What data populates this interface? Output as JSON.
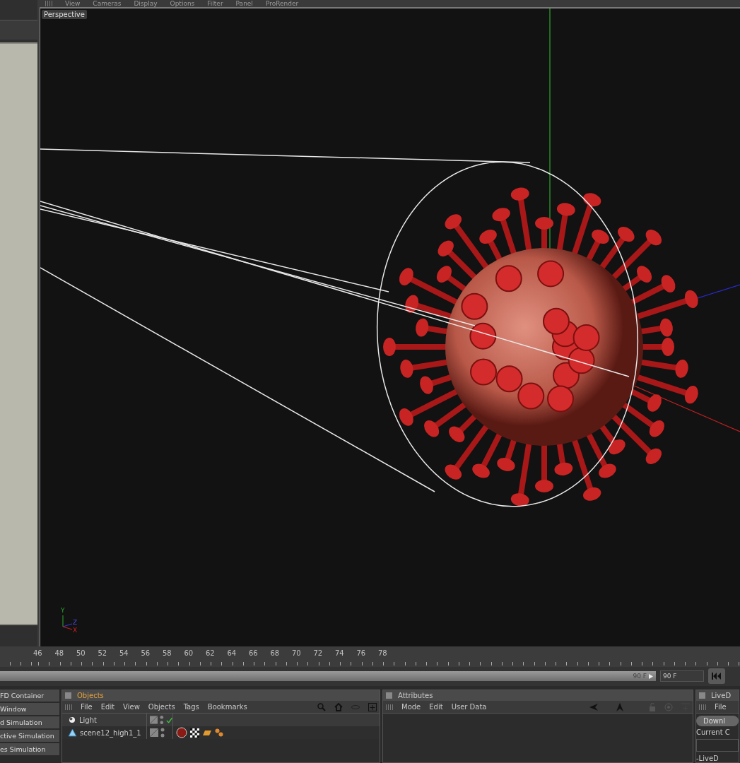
{
  "viewport_menu": [
    "View",
    "Cameras",
    "Display",
    "Options",
    "Filter",
    "Panel",
    "ProRender"
  ],
  "viewport": {
    "camera": "Perspective",
    "axis_labels": {
      "y": "Y",
      "z": "Z",
      "x": "X"
    }
  },
  "left_list": [
    "FD Container",
    "Window",
    "d Simulation",
    "ctive Simulation",
    "es Simulation"
  ],
  "ruler": [
    "46",
    "48",
    "50",
    "52",
    "54",
    "56",
    "58",
    "60",
    "62",
    "64",
    "66",
    "68",
    "70",
    "72",
    "74",
    "76",
    "78"
  ],
  "timeline": {
    "end_label": "90 F",
    "end_field": "90 F",
    "level": 1.0
  },
  "objects": {
    "title": "Objects",
    "menu": [
      "File",
      "Edit",
      "View",
      "Objects",
      "Tags",
      "Bookmarks"
    ],
    "items": [
      {
        "name": "Light",
        "kind": "light",
        "enabled_check": true,
        "has_tags": false
      },
      {
        "name": "scene12_high1_1",
        "kind": "polygon",
        "enabled_check": false,
        "has_tags": true
      }
    ]
  },
  "attributes": {
    "title": "Attributes",
    "menu": [
      "Mode",
      "Edit",
      "User Data"
    ]
  },
  "live": {
    "title": "LiveD",
    "menu": [
      "File"
    ],
    "button": "Downl",
    "label": "Current C",
    "tree_item": "-LiveD"
  }
}
